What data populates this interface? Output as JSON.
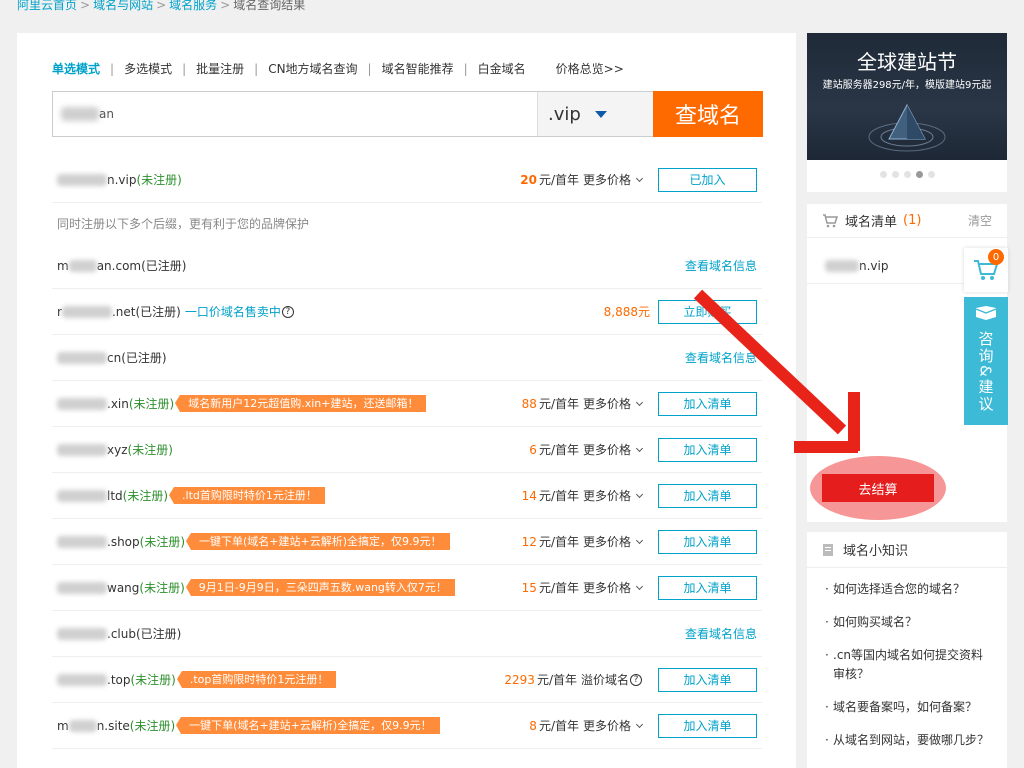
{
  "breadcrumb": {
    "items": [
      "阿里云首页",
      "域名与网站",
      "域名服务"
    ],
    "separator": ">",
    "current": "域名查询结果"
  },
  "tabs": [
    {
      "label": "单选模式",
      "active": true
    },
    {
      "label": "多选模式",
      "active": false
    },
    {
      "label": "批量注册",
      "active": false
    },
    {
      "label": "CN地方域名查询",
      "active": false
    },
    {
      "label": "域名智能推荐",
      "active": false
    },
    {
      "label": "白金域名",
      "active": false
    },
    {
      "label": "价格总览>>",
      "active": false
    }
  ],
  "search": {
    "value": "an",
    "tld": ".vip",
    "button_label": "查域名"
  },
  "primary_result": {
    "domain_suffix": "n.vip",
    "status": "(未注册)",
    "price": "20",
    "price_unit": "元/首年",
    "more_prices": "更多价格",
    "button_label": "已加入"
  },
  "suggestion_note": "同时注册以下多个后缀，更有利于您的品牌保护",
  "results": [
    {
      "name": "m",
      "suffix": "an.com",
      "status": "(已注册)",
      "free": false,
      "info_label": "查看域名信息"
    },
    {
      "name": "r",
      "suffix": ".net",
      "status": "(已注册)",
      "free": false,
      "extra": "一口价域名售卖中",
      "extra_q": "?",
      "price_only": "8,888元",
      "button_label": "立即购买"
    },
    {
      "name": "",
      "suffix": "cn",
      "status": "(已注册)",
      "free": false,
      "info_label": "查看域名信息"
    },
    {
      "name": "",
      "suffix": ".xin",
      "status": "(未注册)",
      "free": true,
      "promo": "域名新用户12元超值购.xin+建站，还送邮箱！",
      "price": "88",
      "price_unit": "元/首年",
      "more": "更多价格",
      "button_label": "加入清单"
    },
    {
      "name": "",
      "suffix": "xyz",
      "status": "(未注册)",
      "free": true,
      "price": "6",
      "price_unit": "元/首年",
      "more": "更多价格",
      "button_label": "加入清单"
    },
    {
      "name": "",
      "suffix": "ltd",
      "status": "(未注册)",
      "free": true,
      "promo": ".ltd首购限时特价1元注册！",
      "price": "14",
      "price_unit": "元/首年",
      "more": "更多价格",
      "button_label": "加入清单"
    },
    {
      "name": "",
      "suffix": ".shop",
      "status": "(未注册)",
      "free": true,
      "promo": "一键下单(域名+建站+云解析)全搞定，仅9.9元！",
      "price": "12",
      "price_unit": "元/首年",
      "more": "更多价格",
      "button_label": "加入清单"
    },
    {
      "name": "",
      "suffix": "wang",
      "status": "(未注册)",
      "free": true,
      "promo": "9月1日-9月9日，三朵四声五数.wang转入仅7元！",
      "price": "15",
      "price_unit": "元/首年",
      "more": "更多价格",
      "button_label": "加入清单"
    },
    {
      "name": "",
      "suffix": ".club",
      "status": "(已注册)",
      "free": false,
      "info_label": "查看域名信息"
    },
    {
      "name": "",
      "suffix": ".top",
      "status": "(未注册)",
      "free": true,
      "promo": ".top首购限时特价1元注册！",
      "price": "2293",
      "price_unit": "元/首年",
      "more": "溢价域名",
      "more_q": "?",
      "button_label": "加入清单"
    },
    {
      "name": "m",
      "suffix": "n.site",
      "status": "(未注册)",
      "free": true,
      "promo": "一键下单(域名+建站+云解析)全搞定，仅9.9元！",
      "price": "8",
      "price_unit": "元/首年",
      "more": "更多价格",
      "button_label": "加入清单"
    }
  ],
  "banner": {
    "title": "全球建站节",
    "subtitle": "建站服务器298元/年，模版建站9元起",
    "dots": 5,
    "active_dot": 3
  },
  "cart": {
    "title": "域名清单",
    "count": "(1)",
    "clear_label": "清空",
    "items": [
      {
        "suffix": "n.vip"
      }
    ],
    "checkout_label": "去结算"
  },
  "float_cart": {
    "badge": "0"
  },
  "float_consult": {
    "label": "咨询&建议"
  },
  "knowledge": {
    "title": "域名小知识",
    "items": [
      "如何选择适合您的域名？",
      "如何购买域名？",
      ".cn等国内域名如何提交资料审核？",
      "域名要备案吗，如何备案？",
      "从域名到网站，要做哪几步？"
    ]
  },
  "colors": {
    "accent": "#00a2ca",
    "orange": "#ff6a00",
    "checkout": "#e51d1d",
    "annotation": "#e8241a"
  }
}
